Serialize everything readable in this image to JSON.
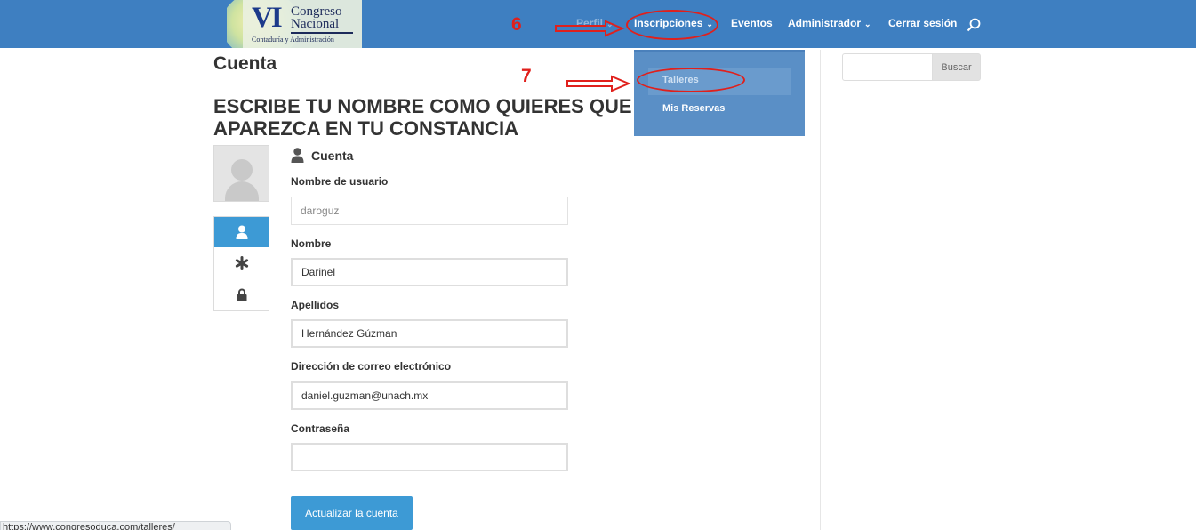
{
  "header": {
    "logo": {
      "numeral": "VI",
      "line1": "Congreso",
      "line2": "Nacional",
      "line3": "Contaduría y Administración"
    },
    "nav": [
      {
        "label": "Perfil",
        "has_caret": true
      },
      {
        "label": "Inscripciones",
        "has_caret": true
      },
      {
        "label": "Eventos",
        "has_caret": false
      },
      {
        "label": "Administrador",
        "has_caret": true
      },
      {
        "label": "Cerrar sesión",
        "has_caret": false
      }
    ],
    "caret_glyph": "⌄",
    "search_icon": "search-icon"
  },
  "annotations": {
    "step6": "6",
    "step7": "7",
    "color": "#e0201c"
  },
  "dropdown": {
    "items": [
      "Talleres",
      "Mis Reservas"
    ]
  },
  "main": {
    "page_title": "Cuenta",
    "headline": "ESCRIBE TU NOMBRE COMO QUIERES QUE APAREZCA EN TU CONSTANCIA",
    "section_title": "Cuenta",
    "tab_icons": [
      "user-icon",
      "asterisk-icon",
      "lock-icon"
    ],
    "fields": {
      "username": {
        "label": "Nombre de usuario",
        "value": "daroguz"
      },
      "first_name": {
        "label": "Nombre",
        "value": "Darinel"
      },
      "last_name": {
        "label": "Apellidos",
        "value": "Hernández Gúzman"
      },
      "email": {
        "label": "Dirección de correo electrónico",
        "value": "daniel.guzman@unach.mx"
      },
      "password": {
        "label": "Contraseña",
        "value": ""
      }
    },
    "submit_label": "Actualizar la cuenta"
  },
  "sidebar": {
    "search_button": "Buscar"
  },
  "status_bar": {
    "url": "https://www.congresoduca.com/talleres/"
  },
  "colors": {
    "header": "#3e7fc1",
    "accent": "#3d9ad5",
    "dropdown": "#5a8fc6"
  }
}
